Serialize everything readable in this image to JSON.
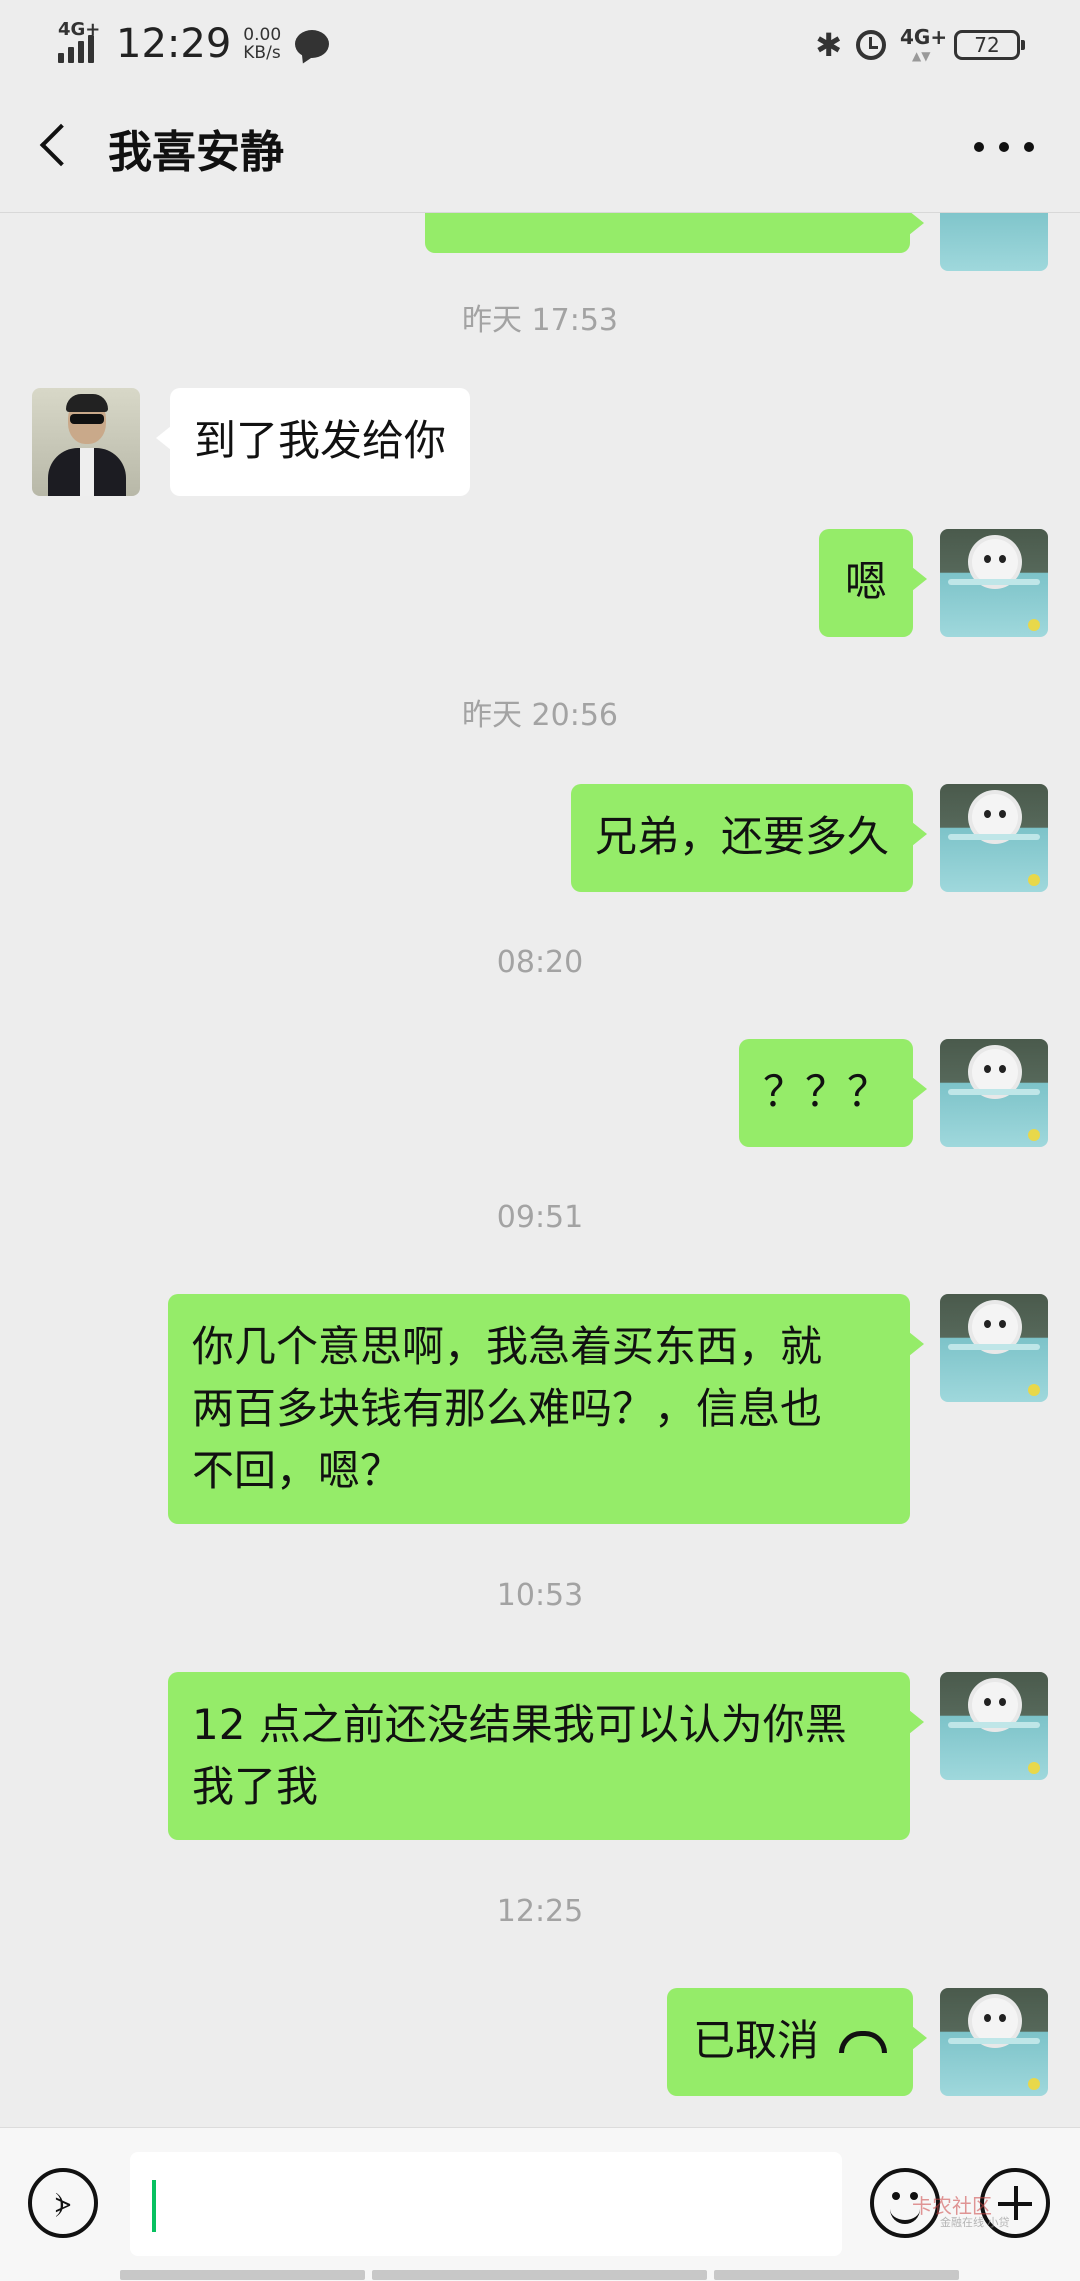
{
  "status_bar": {
    "network_left": "4G+",
    "time": "12:29",
    "speed_value": "0.00",
    "speed_unit": "KB/s",
    "network_right": "4G+",
    "battery": "72",
    "icons": [
      "signal-icon",
      "chat-notification-icon",
      "bluetooth-icon",
      "alarm-icon",
      "battery-icon"
    ]
  },
  "header": {
    "title": "我喜安静",
    "icons": [
      "back-icon",
      "more-icon"
    ]
  },
  "chat": {
    "timestamps": [
      "昨天 17:53",
      "昨天 20:56",
      "08:20",
      "09:51",
      "10:53",
      "12:25"
    ],
    "messages": [
      {
        "side": "in",
        "text": "到了我发给你"
      },
      {
        "side": "out",
        "text": "嗯"
      },
      {
        "side": "out",
        "text": "兄弟，还要多久"
      },
      {
        "side": "out",
        "text": "？？？"
      },
      {
        "side": "out",
        "lines": [
          "你几个意思啊，我急着买东西，就",
          "两百多块钱有那么难吗？，信息也",
          "不回，嗯？"
        ]
      },
      {
        "side": "out",
        "lines": [
          "12 点之前还没结果我可以认为你黑",
          "我了我"
        ]
      },
      {
        "side": "out",
        "text": "已取消",
        "icon": "call-ended-icon"
      }
    ]
  },
  "input_bar": {
    "value": "",
    "icons": [
      "voice-icon",
      "emoji-icon",
      "plus-icon"
    ]
  },
  "watermark": {
    "text": "卡农社区",
    "sub": "金融在线 小贷"
  },
  "colors": {
    "background": "#ededed",
    "bubble_out": "#95ec69",
    "bubble_in": "#ffffff",
    "timestamp": "#a3a3a3",
    "caret": "#07c160"
  }
}
